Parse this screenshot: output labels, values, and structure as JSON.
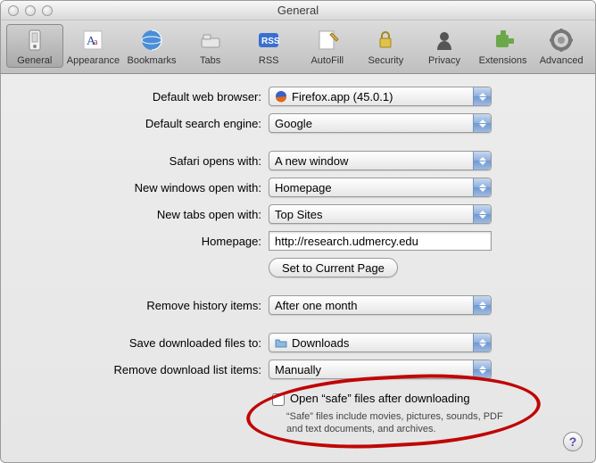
{
  "window": {
    "title": "General"
  },
  "toolbar": {
    "items": [
      {
        "label": "General",
        "selected": true
      },
      {
        "label": "Appearance",
        "selected": false
      },
      {
        "label": "Bookmarks",
        "selected": false
      },
      {
        "label": "Tabs",
        "selected": false
      },
      {
        "label": "RSS",
        "selected": false
      },
      {
        "label": "AutoFill",
        "selected": false
      },
      {
        "label": "Security",
        "selected": false
      },
      {
        "label": "Privacy",
        "selected": false
      },
      {
        "label": "Extensions",
        "selected": false
      },
      {
        "label": "Advanced",
        "selected": false
      }
    ]
  },
  "form": {
    "default_browser_label": "Default web browser:",
    "default_browser_value": "Firefox.app (45.0.1)",
    "default_search_label": "Default search engine:",
    "default_search_value": "Google",
    "opens_with_label": "Safari opens with:",
    "opens_with_value": "A new window",
    "new_windows_label": "New windows open with:",
    "new_windows_value": "Homepage",
    "new_tabs_label": "New tabs open with:",
    "new_tabs_value": "Top Sites",
    "homepage_label": "Homepage:",
    "homepage_value": "http://research.udmercy.edu",
    "set_current_page": "Set to Current Page",
    "remove_history_label": "Remove history items:",
    "remove_history_value": "After one month",
    "save_downloads_label": "Save downloaded files to:",
    "save_downloads_value": "Downloads",
    "remove_dl_list_label": "Remove download list items:",
    "remove_dl_list_value": "Manually",
    "open_safe_label": "Open “safe” files after downloading",
    "open_safe_desc": "“Safe” files include movies, pictures, sounds, PDF and text documents, and archives.",
    "open_safe_checked": false
  },
  "help": "?"
}
